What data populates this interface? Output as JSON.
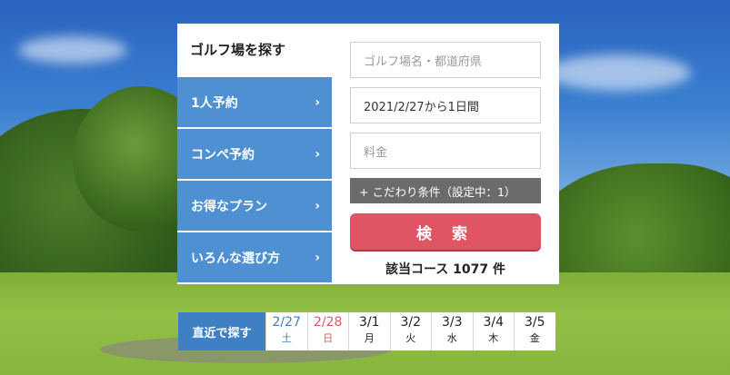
{
  "panel": {
    "title": "ゴルフ場を探す",
    "nav": [
      {
        "label": "1人予約",
        "chevron": "›"
      },
      {
        "label": "コンペ予約",
        "chevron": "›"
      },
      {
        "label": "お得なプラン",
        "chevron": "›"
      },
      {
        "label": "いろんな選び方",
        "chevron": "›"
      }
    ],
    "search": {
      "course_placeholder": "ゴルフ場名・都道府県",
      "date_value": "2021/2/27から1日間",
      "price_placeholder": "料金",
      "conditions_label": "+ こだわり条件（設定中：1）",
      "search_button": "検 索",
      "result_text": "該当コース  1077 件"
    }
  },
  "date_strip": {
    "label": "直近で探す",
    "dates": [
      {
        "date": "2/27",
        "weekday": "土",
        "kind": "sat"
      },
      {
        "date": "2/28",
        "weekday": "日",
        "kind": "sun"
      },
      {
        "date": "3/1",
        "weekday": "月",
        "kind": "wk"
      },
      {
        "date": "3/2",
        "weekday": "火",
        "kind": "wk"
      },
      {
        "date": "3/3",
        "weekday": "水",
        "kind": "wk"
      },
      {
        "date": "3/4",
        "weekday": "木",
        "kind": "wk"
      },
      {
        "date": "3/5",
        "weekday": "金",
        "kind": "wk"
      }
    ]
  },
  "colors": {
    "nav_blue": "#4e90d2",
    "search_red": "#e05563",
    "condition_gray": "#6b6b6b",
    "saturday_blue": "#3f7fc4",
    "sunday_red": "#e05563"
  }
}
